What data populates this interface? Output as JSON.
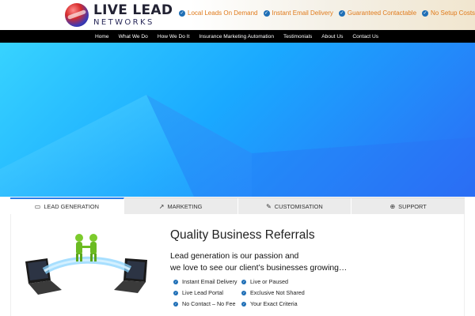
{
  "header": {
    "logo_main": "LIVE LEAD",
    "logo_sub": "NETWORKS",
    "features": [
      "Local Leads On Demand",
      "Instant Email Delivery",
      "Guaranteed Contactable",
      "No Setup Costs!"
    ]
  },
  "nav": {
    "items": [
      "Home",
      "What We Do",
      "How We Do It",
      "Insurance Marketing Automation",
      "Testimonials",
      "About Us",
      "Contact Us"
    ]
  },
  "tabs": [
    {
      "label": "LEAD GENERATION",
      "icon": "laptop-icon",
      "active": true
    },
    {
      "label": "MARKETING",
      "icon": "chart-icon",
      "active": false
    },
    {
      "label": "CUSTOMISATION",
      "icon": "edit-icon",
      "active": false
    },
    {
      "label": "SUPPORT",
      "icon": "lifebuoy-icon",
      "active": false
    }
  ],
  "content": {
    "title": "Quality Business Referrals",
    "tagline_line1": "Lead generation is our passion and",
    "tagline_line2": "we love to see our client’s businesses growing…",
    "bullets_left": [
      "Instant Email Delivery",
      "Live Lead Portal",
      "No Contact – No Fee"
    ],
    "bullets_right": [
      "Live or Paused",
      "Exclusive Not Shared",
      "Your Exact Criteria"
    ]
  },
  "colors": {
    "accent_orange": "#e07a1b",
    "check_blue": "#1f6fb6",
    "tab_active": "#2b7de9",
    "hero_start": "#37d3ff",
    "hero_end": "#2b6cf5"
  }
}
